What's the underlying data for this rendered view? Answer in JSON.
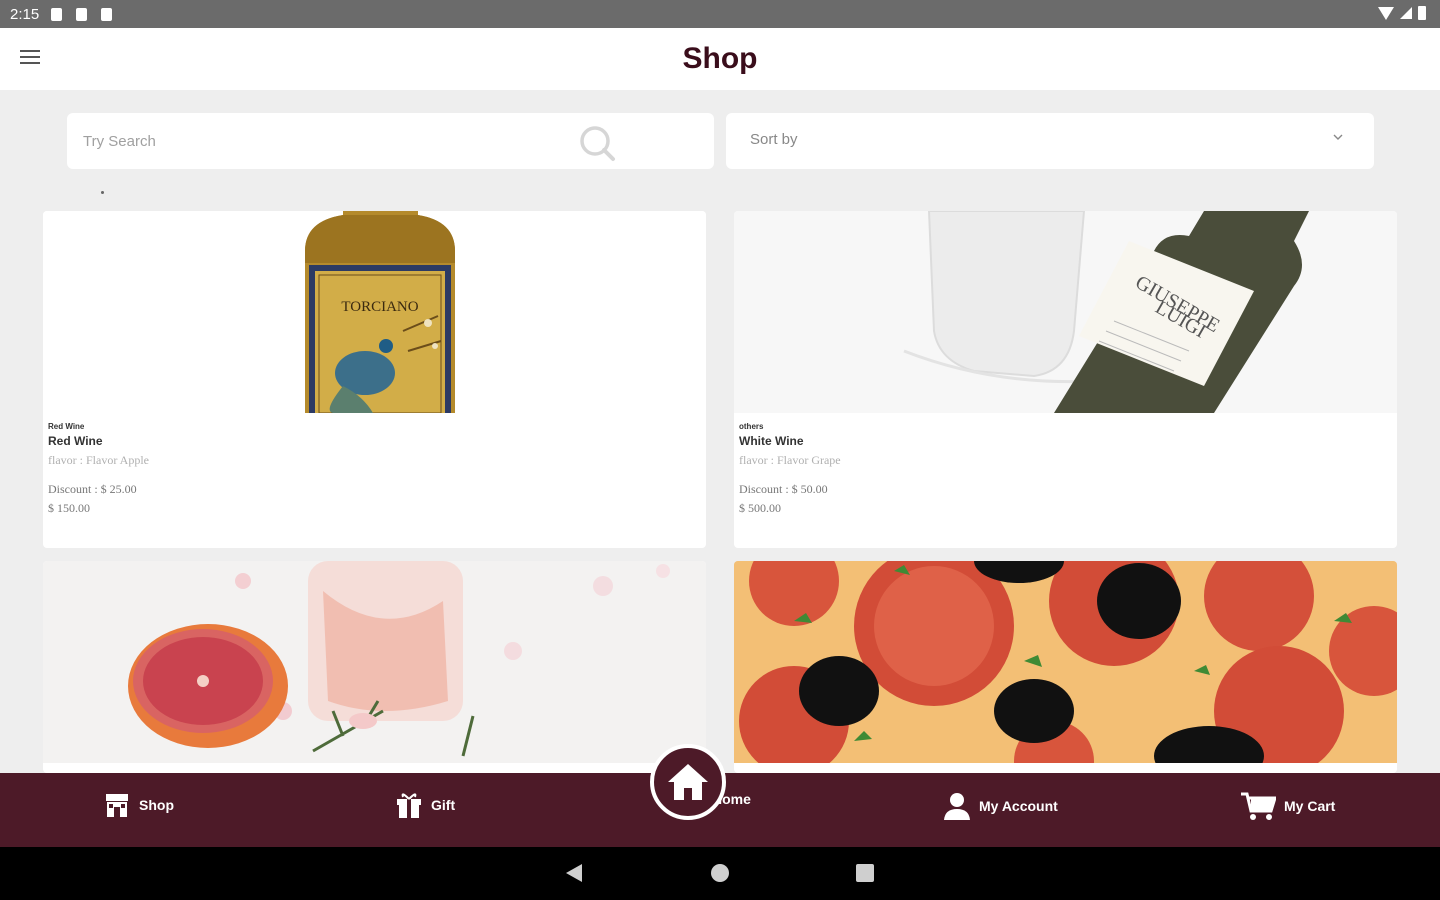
{
  "status_bar": {
    "time": "2:15"
  },
  "header": {
    "title": "Shop"
  },
  "search": {
    "placeholder": "Try Search"
  },
  "sort": {
    "label": "Sort by"
  },
  "products": [
    {
      "category": "Red Wine",
      "name": "Red Wine",
      "flavor": "flavor : Flavor Apple",
      "discount": "Discount : $ 25.00",
      "price": "$ 150.00"
    },
    {
      "category": "others",
      "name": "White Wine",
      "flavor": "flavor : Flavor Grape",
      "discount": "Discount : $ 50.00",
      "price": "$ 500.00"
    },
    {
      "category": "",
      "name": "",
      "flavor": "",
      "discount": "",
      "price": ""
    },
    {
      "category": "",
      "name": "",
      "flavor": "",
      "discount": "",
      "price": ""
    }
  ],
  "bottom_nav": {
    "shop": "Shop",
    "gift": "Gift",
    "home": "Home",
    "account": "My Account",
    "cart": "My Cart"
  },
  "colors": {
    "brand": "#4d1a28",
    "title": "#3a0d1b",
    "background": "#eeeeee"
  },
  "icons": [
    "menu-icon",
    "search-icon",
    "chevron-down-icon",
    "store-icon",
    "gift-icon",
    "home-icon",
    "user-icon",
    "cart-icon"
  ]
}
